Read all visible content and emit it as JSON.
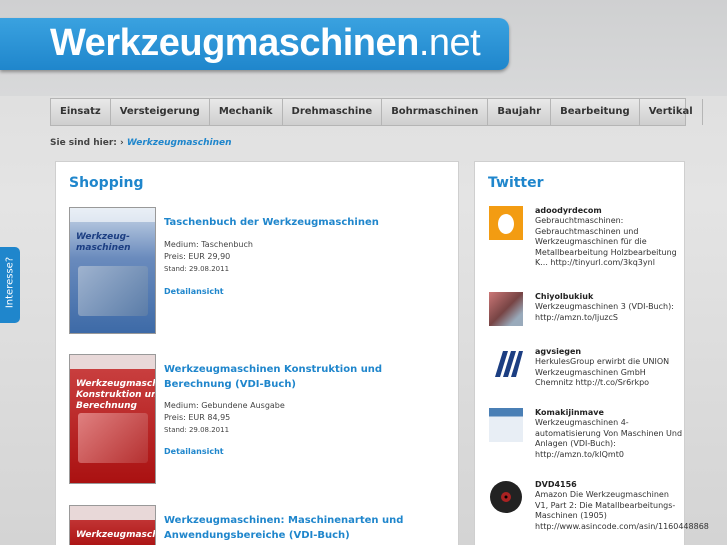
{
  "header": {
    "logo_bold": "Werkzeugmaschinen",
    "logo_suffix": ".net"
  },
  "nav": {
    "items": [
      "Einsatz",
      "Versteigerung",
      "Mechanik",
      "Drehmaschine",
      "Bohrmaschinen",
      "Baujahr",
      "Bearbeitung",
      "Vertikal"
    ]
  },
  "breadcrumb": {
    "prefix": "Sie sind hier:",
    "separator": "›",
    "current": "Werkzeugmaschinen"
  },
  "sidebar_tab": {
    "label": "Interesse?"
  },
  "shopping": {
    "title": "Shopping",
    "products": [
      {
        "title": "Taschenbuch der Werkzeugmaschinen",
        "medium": "Medium: Taschenbuch",
        "price": "Preis: EUR 29,90",
        "stand": "Stand: 29.08.2011",
        "detail": "Detailansicht",
        "cover_text": "Werkzeug-\nmaschinen"
      },
      {
        "title": "Werkzeugmaschinen Konstruktion und Berechnung (VDI-Buch)",
        "medium": "Medium: Gebundene Ausgabe",
        "price": "Preis: EUR 84,95",
        "stand": "Stand: 29.08.2011",
        "detail": "Detailansicht",
        "cover_text": "Werkzeugmaschinen\nKonstruktion und\nBerechnung"
      },
      {
        "title": "Werkzeugmaschinen: Maschinenarten und Anwendungsbereiche (VDI-Buch)",
        "cover_text": "Werkzeugmaschinen"
      }
    ]
  },
  "twitter": {
    "title": "Twitter",
    "tweets": [
      {
        "user": "adoodyrdecom",
        "text": "Gebrauchtmaschinen: Gebrauchtmaschinen und Werkzeugmaschinen für die Metallbearbeitung Holzbearbeitung K... http://tinyurl.com/3kq3ynl",
        "avatar": "egg-avatar-icon"
      },
      {
        "user": "Chiyolbukiuk",
        "text": "Werkzeugmaschinen 3 (VDI-Buch): http://amzn.to/ljuzcS",
        "avatar": "machine-avatar-icon"
      },
      {
        "user": "agvsiegen",
        "text": "HerkulesGroup erwirbt die UNION Werkzeugmaschinen GmbH Chemnitz http://t.co/Sr6rkpo",
        "avatar": "stripes-avatar-icon"
      },
      {
        "user": "Komakijinmave",
        "text": "Werkzeugmaschinen 4-automatisierung Von Maschinen Und Anlagen (VDI-Buch): http://amzn.to/klQmt0",
        "avatar": "screenshot-avatar-icon"
      },
      {
        "user": "DVD4156",
        "text": "Amazon Die Werkzeugmaschinen V1, Part 2: Die Matallbearbeitungs-Maschinen (1905) http://www.asincode.com/asin/1160448868",
        "avatar": "disc-avatar-icon"
      }
    ]
  },
  "colors": {
    "accent": "#1f86cc",
    "background": "#d9dadb"
  }
}
